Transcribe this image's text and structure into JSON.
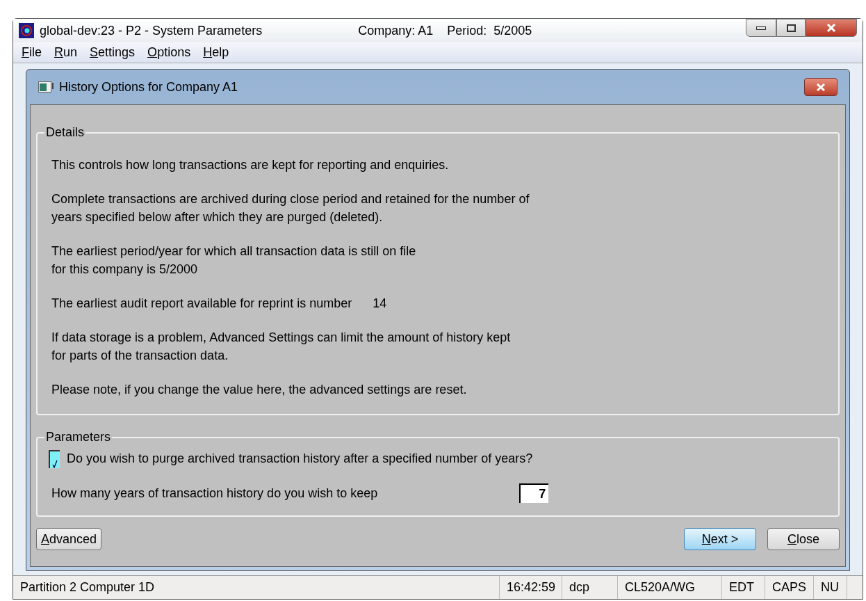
{
  "window": {
    "title": "global-dev:23 - P2 - System Parameters",
    "company": "Company: A1",
    "period": "Period:  5/2005"
  },
  "menu": [
    {
      "label": "File"
    },
    {
      "label": "Run"
    },
    {
      "label": "Settings"
    },
    {
      "label": "Options"
    },
    {
      "label": "Help"
    }
  ],
  "dialog": {
    "title": "History Options for Company A1",
    "details": {
      "legend": "Details",
      "paragraphs": [
        {
          "text": "This controls how long transactions are kept for reporting and enquiries."
        },
        {
          "text": "Complete transactions are archived during close period and retained for the number of\nyears specified below after which they are purged (deleted)."
        },
        {
          "text": "The earliest period/year for which all transaction data is still on file\nfor this company is 5/2000"
        },
        {
          "text": "The earliest audit report available for reprint is number",
          "value": "14"
        },
        {
          "text": "If data storage is a problem, Advanced Settings can limit the amount of history kept\nfor parts of the transaction data."
        },
        {
          "text": "Please note, if you change the value here, the advanced settings are reset."
        }
      ]
    },
    "parameters": {
      "legend": "Parameters",
      "purge": {
        "label": "Do you wish to purge archived transaction history after a specified number of years?",
        "checked": true
      },
      "years": {
        "label": "How many years of transaction history do you wish to keep",
        "value": "7"
      }
    },
    "buttons": [
      {
        "label": "Advanced",
        "default": false
      },
      {
        "label": "Next >",
        "default": true
      },
      {
        "label": "Close",
        "default": false
      }
    ]
  },
  "status_bar": [
    "Partition 2 Computer 1D",
    "16:42:59",
    "dcp",
    "CL520A/WG",
    "EDT",
    "CAPS",
    "NU"
  ]
}
